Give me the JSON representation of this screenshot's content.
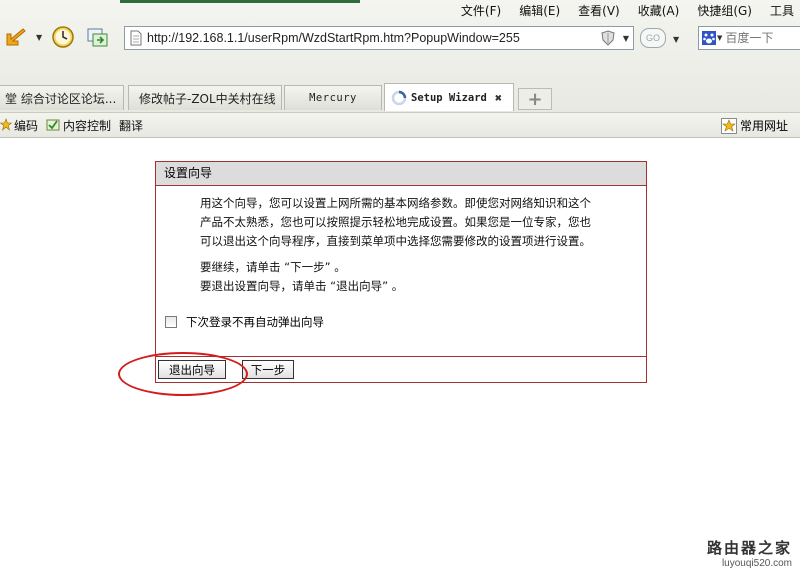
{
  "menubar": {
    "items": [
      "文件(F)",
      "编辑(E)",
      "查看(V)",
      "收藏(A)",
      "快捷组(G)",
      "工具"
    ]
  },
  "navbar": {
    "address_url": "http://192.168.1.1/userRpm/WzdStartRpm.htm?PopupWindow=255",
    "go_label": "GO",
    "search_placeholder": "百度一下"
  },
  "tabs": [
    {
      "label": "堂 综合讨论区论坛..."
    },
    {
      "label": "修改帖子-ZOL中关村在线"
    },
    {
      "label": "Mercury"
    },
    {
      "label": "Setup Wizard",
      "active": true
    }
  ],
  "bookmarks": {
    "encoding": "编码",
    "content_control": "内容控制",
    "translate": "翻译",
    "common_sites": "常用网址"
  },
  "wizard": {
    "title": "设置向导",
    "paragraph_lines": [
      "用这个向导，您可以设置上网所需的基本网络参数。即使您对网络知识和这个",
      "产品不太熟悉，您也可以按照提示轻松地完成设置。如果您是一位专家，您也",
      "可以退出这个向导程序，直接到菜单项中选择您需要修改的设置项进行设置。"
    ],
    "continue_line": "要继续，请单击 “下一步” 。",
    "exit_line": "要退出设置向导，请单击 “退出向导” 。",
    "checkbox_label": "下次登录不再自动弹出向导",
    "exit_button": "退出向导",
    "next_button": "下一步"
  },
  "watermark": {
    "title": "路由器之家",
    "url": "luyouqi520.com"
  },
  "colors": {
    "wizard_border": "#a43030",
    "highlight_circle": "#d41c1c",
    "header_bg": "#dcdcdc"
  }
}
